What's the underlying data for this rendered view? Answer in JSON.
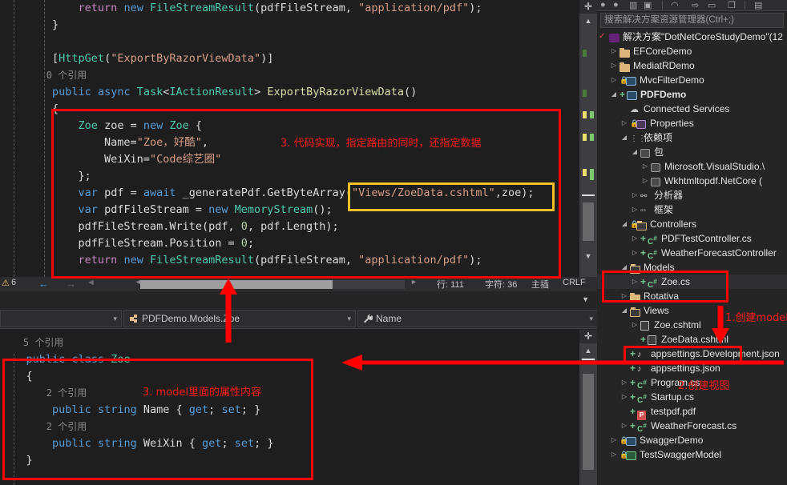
{
  "editor_top": {
    "lines": [
      [
        {
          "t": "            ",
          "c": "plain"
        },
        {
          "t": "return",
          "c": "ctrl"
        },
        {
          "t": " ",
          "c": "plain"
        },
        {
          "t": "new",
          "c": "kw"
        },
        {
          "t": " ",
          "c": "plain"
        },
        {
          "t": "FileStreamResult",
          "c": "type"
        },
        {
          "t": "(pdfFileStream, ",
          "c": "plain"
        },
        {
          "t": "\"application/pdf\"",
          "c": "str"
        },
        {
          "t": ");",
          "c": "plain"
        }
      ],
      [
        {
          "t": "        }",
          "c": "plain"
        }
      ],
      [
        {
          "t": "",
          "c": "plain"
        }
      ],
      [
        {
          "t": "        [",
          "c": "plain"
        },
        {
          "t": "HttpGet",
          "c": "type"
        },
        {
          "t": "(",
          "c": "plain"
        },
        {
          "t": "\"ExportByRazorViewData\"",
          "c": "str"
        },
        {
          "t": ")]",
          "c": "plain"
        }
      ],
      [
        {
          "t": "        0 个引用",
          "c": "ref"
        }
      ],
      [
        {
          "t": "        ",
          "c": "plain"
        },
        {
          "t": "public",
          "c": "kw"
        },
        {
          "t": " ",
          "c": "plain"
        },
        {
          "t": "async",
          "c": "kw"
        },
        {
          "t": " ",
          "c": "plain"
        },
        {
          "t": "Task",
          "c": "type"
        },
        {
          "t": "<",
          "c": "plain"
        },
        {
          "t": "IActionResult",
          "c": "type"
        },
        {
          "t": "> ",
          "c": "plain"
        },
        {
          "t": "ExportByRazorViewData",
          "c": "meth"
        },
        {
          "t": "()",
          "c": "plain"
        }
      ],
      [
        {
          "t": "        {",
          "c": "plain"
        }
      ],
      [
        {
          "t": "            ",
          "c": "plain"
        },
        {
          "t": "Zoe",
          "c": "type"
        },
        {
          "t": " ",
          "c": "plain"
        },
        {
          "t": "zoe",
          "c": "plain"
        },
        {
          "t": " = ",
          "c": "plain"
        },
        {
          "t": "new",
          "c": "kw"
        },
        {
          "t": " ",
          "c": "plain"
        },
        {
          "t": "Zoe",
          "c": "type"
        },
        {
          "t": " {",
          "c": "plain"
        }
      ],
      [
        {
          "t": "                Name=",
          "c": "plain"
        },
        {
          "t": "\"Zoe，好酷\"",
          "c": "str"
        },
        {
          "t": ",",
          "c": "plain"
        }
      ],
      [
        {
          "t": "                WeiXin=",
          "c": "plain"
        },
        {
          "t": "\"Code综艺圈\"",
          "c": "str"
        }
      ],
      [
        {
          "t": "            };",
          "c": "plain"
        }
      ],
      [
        {
          "t": "            ",
          "c": "plain"
        },
        {
          "t": "var",
          "c": "kw"
        },
        {
          "t": " ",
          "c": "plain"
        },
        {
          "t": "pdf",
          "c": "plain"
        },
        {
          "t": " = ",
          "c": "plain"
        },
        {
          "t": "await",
          "c": "kw"
        },
        {
          "t": " _generatePdf.",
          "c": "plain"
        },
        {
          "t": "GetByteArray",
          "c": "plain"
        },
        {
          "t": "(",
          "c": "plain"
        },
        {
          "t": "\"Views/ZoeData.cshtml\"",
          "c": "str"
        },
        {
          "t": ",zoe);",
          "c": "plain"
        }
      ],
      [
        {
          "t": "            ",
          "c": "plain"
        },
        {
          "t": "var",
          "c": "kw"
        },
        {
          "t": " ",
          "c": "plain"
        },
        {
          "t": "pdfFileStream",
          "c": "plain"
        },
        {
          "t": " = ",
          "c": "plain"
        },
        {
          "t": "new",
          "c": "kw"
        },
        {
          "t": " ",
          "c": "plain"
        },
        {
          "t": "MemoryStream",
          "c": "type"
        },
        {
          "t": "();",
          "c": "plain"
        }
      ],
      [
        {
          "t": "            pdfFileStream.Write(pdf, ",
          "c": "plain"
        },
        {
          "t": "0",
          "c": "num"
        },
        {
          "t": ", pdf.Length);",
          "c": "plain"
        }
      ],
      [
        {
          "t": "            pdfFileStream.Position = ",
          "c": "plain"
        },
        {
          "t": "0",
          "c": "num"
        },
        {
          "t": ";",
          "c": "plain"
        }
      ],
      [
        {
          "t": "            ",
          "c": "plain"
        },
        {
          "t": "return",
          "c": "ctrl"
        },
        {
          "t": " ",
          "c": "plain"
        },
        {
          "t": "new",
          "c": "kw"
        },
        {
          "t": " ",
          "c": "plain"
        },
        {
          "t": "FileStreamResult",
          "c": "type"
        },
        {
          "t": "(pdfFileStream, ",
          "c": "plain"
        },
        {
          "t": "\"application/pdf\"",
          "c": "str"
        },
        {
          "t": ");",
          "c": "plain"
        }
      ]
    ]
  },
  "editor_status": {
    "warning_count": "6",
    "back_arrow": "←",
    "forward_arrow": "→",
    "line_label": "行: 111",
    "char_label": "字符: 36",
    "insert_label": "主插",
    "eol_label": "CRLF"
  },
  "navbar": {
    "left_combo_value": "",
    "type_combo_value": "PDFDemo.Models.Zoe",
    "member_combo_value": "Name",
    "type_icon": "class-icon",
    "member_icon": "wrench-icon",
    "caret": "▾"
  },
  "editor_bottom": {
    "lines": [
      [
        {
          "t": "    5 个引用",
          "c": "ref"
        }
      ],
      [
        {
          "t": "    ",
          "c": "plain"
        },
        {
          "t": "public",
          "c": "kw"
        },
        {
          "t": " ",
          "c": "plain"
        },
        {
          "t": "class",
          "c": "kw"
        },
        {
          "t": " ",
          "c": "plain"
        },
        {
          "t": "Zoe",
          "c": "type"
        }
      ],
      [
        {
          "t": "    {",
          "c": "plain"
        }
      ],
      [
        {
          "t": "        2 个引用",
          "c": "ref"
        }
      ],
      [
        {
          "t": "        ",
          "c": "plain"
        },
        {
          "t": "public",
          "c": "kw"
        },
        {
          "t": " ",
          "c": "plain"
        },
        {
          "t": "string",
          "c": "kw"
        },
        {
          "t": " ",
          "c": "plain"
        },
        {
          "t": "Name",
          "c": "plain"
        },
        {
          "t": " { ",
          "c": "plain"
        },
        {
          "t": "get",
          "c": "kw"
        },
        {
          "t": "; ",
          "c": "plain"
        },
        {
          "t": "set",
          "c": "kw"
        },
        {
          "t": "; }",
          "c": "plain"
        }
      ],
      [
        {
          "t": "        2 个引用",
          "c": "ref"
        }
      ],
      [
        {
          "t": "        ",
          "c": "plain"
        },
        {
          "t": "public",
          "c": "kw"
        },
        {
          "t": " ",
          "c": "plain"
        },
        {
          "t": "string",
          "c": "kw"
        },
        {
          "t": " ",
          "c": "plain"
        },
        {
          "t": "WeiXin",
          "c": "plain"
        },
        {
          "t": " { ",
          "c": "plain"
        },
        {
          "t": "get",
          "c": "kw"
        },
        {
          "t": "; ",
          "c": "plain"
        },
        {
          "t": "set",
          "c": "kw"
        },
        {
          "t": "; }",
          "c": "plain"
        }
      ],
      [
        {
          "t": "    }",
          "c": "plain"
        }
      ]
    ]
  },
  "solution_explorer": {
    "search_placeholder": "搜索解决方案资源管理器(Ctrl+;)",
    "toolbar_icons": [
      "back-icon",
      "forward-icon",
      "home-icon",
      "new-folder-icon",
      "pending-changes-icon",
      "show-all-files-icon",
      "refresh-icon",
      "collapse-all-icon",
      "properties-icon",
      "view-code-icon"
    ],
    "tree": [
      {
        "depth": 0,
        "tw": "✓",
        "icon": "vs-solution-icon",
        "label": "解决方案\"DotNetCoreStudyDemo\"(12",
        "bold": false
      },
      {
        "depth": 1,
        "tw": "▷",
        "icon": "folder-icon",
        "label": "EFCoreDemo"
      },
      {
        "depth": 1,
        "tw": "▷",
        "icon": "folder-icon",
        "label": "MediatRDemo"
      },
      {
        "depth": 1,
        "tw": "▷",
        "icon": "web-project-icon",
        "label": "MvcFilterDemo",
        "lock": true
      },
      {
        "depth": 1,
        "tw": "◢",
        "icon": "web-project-icon",
        "label": "PDFDemo",
        "bold": true,
        "plus": true
      },
      {
        "depth": 2,
        "tw": "",
        "icon": "connected-services-icon",
        "label": "Connected Services"
      },
      {
        "depth": 2,
        "tw": "▷",
        "icon": "properties-icon",
        "label": "Properties",
        "lock": true
      },
      {
        "depth": 2,
        "tw": "◢",
        "icon": "dependencies-icon",
        "label": "依赖项"
      },
      {
        "depth": 3,
        "tw": "◢",
        "icon": "package-icon",
        "label": "包"
      },
      {
        "depth": 4,
        "tw": "▷",
        "icon": "package-icon",
        "label": "Microsoft.VisualStudio.\\"
      },
      {
        "depth": 4,
        "tw": "▷",
        "icon": "package-icon",
        "label": "Wkhtmltopdf.NetCore ("
      },
      {
        "depth": 3,
        "tw": "▷",
        "icon": "analyzer-icon",
        "label": "分析器"
      },
      {
        "depth": 3,
        "tw": "▷",
        "icon": "framework-icon",
        "label": "框架"
      },
      {
        "depth": 2,
        "tw": "◢",
        "icon": "folder-open-icon",
        "label": "Controllers",
        "lock": true
      },
      {
        "depth": 3,
        "tw": "▷",
        "icon": "csharp-icon",
        "label": "PDFTestController.cs",
        "plus": true
      },
      {
        "depth": 3,
        "tw": "▷",
        "icon": "csharp-icon",
        "label": "WeatherForecastController",
        "plus": true
      },
      {
        "depth": 2,
        "tw": "◢",
        "icon": "folder-open-icon",
        "label": "Models"
      },
      {
        "depth": 3,
        "tw": "▷",
        "icon": "csharp-icon",
        "label": "Zoe.cs",
        "plus": true,
        "selected": true
      },
      {
        "depth": 2,
        "tw": "▷",
        "icon": "folder-icon",
        "label": "Rotativa"
      },
      {
        "depth": 2,
        "tw": "◢",
        "icon": "folder-open-icon",
        "label": "Views"
      },
      {
        "depth": 3,
        "tw": "▷",
        "icon": "razor-icon",
        "label": "Zoe.cshtml"
      },
      {
        "depth": 3,
        "tw": "",
        "icon": "razor-icon",
        "label": "ZoeData.cshtml",
        "plus": true
      },
      {
        "depth": 2,
        "tw": "",
        "icon": "json-icon",
        "label": "appsettings.Development.json",
        "plus": true
      },
      {
        "depth": 2,
        "tw": "",
        "icon": "json-icon",
        "label": "appsettings.json",
        "plus": true
      },
      {
        "depth": 2,
        "tw": "▷",
        "icon": "csharp-icon",
        "label": "Program.cs",
        "plus": true
      },
      {
        "depth": 2,
        "tw": "▷",
        "icon": "csharp-icon",
        "label": "Startup.cs",
        "plus": true
      },
      {
        "depth": 2,
        "tw": "",
        "icon": "pdf-icon",
        "label": "testpdf.pdf",
        "plus": true
      },
      {
        "depth": 2,
        "tw": "▷",
        "icon": "csharp-icon",
        "label": "WeatherForecast.cs",
        "plus": true
      },
      {
        "depth": 1,
        "tw": "▷",
        "icon": "web-project-icon",
        "label": "SwaggerDemo",
        "lock": true
      },
      {
        "depth": 1,
        "tw": "▷",
        "icon": "csharp-project-icon",
        "label": "TestSwaggerModel",
        "lock": true
      }
    ]
  },
  "annotations": {
    "color_red": "#ff0000",
    "color_yellow": "#f2c029",
    "note_code": "3. 代码实现，指定路由的同时，还指定数据",
    "note_model_props": "3. model里面的属性内容",
    "note_create_model": "1.创建model",
    "note_create_view": "2.创建视图"
  }
}
